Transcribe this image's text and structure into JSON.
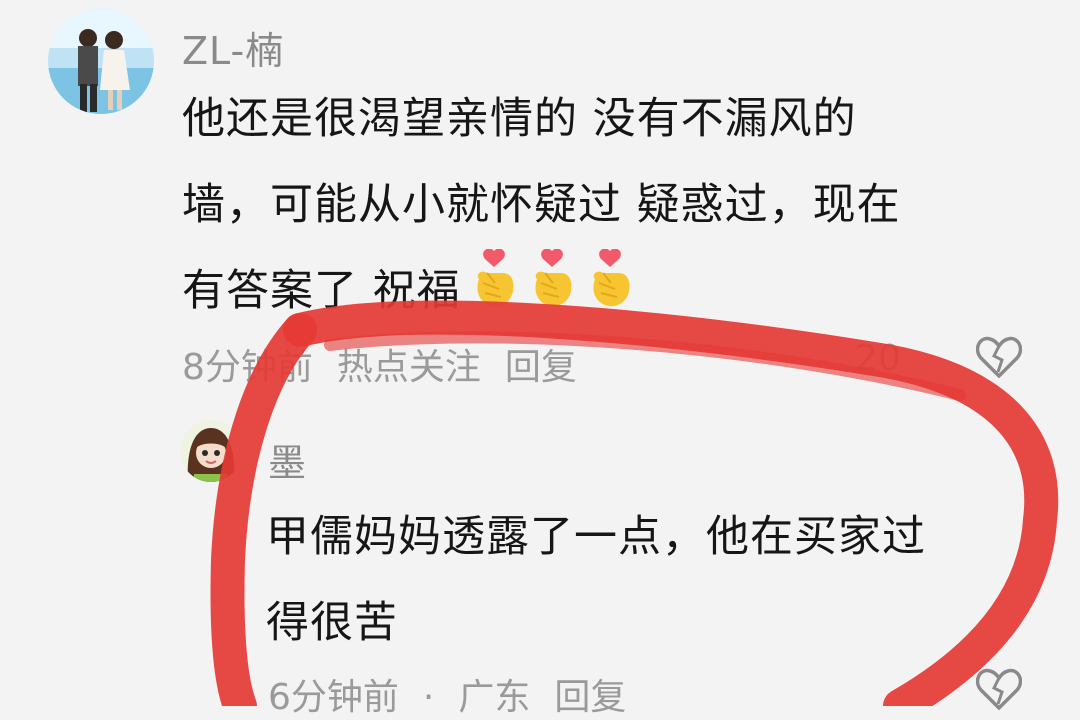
{
  "comment1": {
    "username": "ZL-楠",
    "text_line1": "他还是很渴望亲情的  没有不漏风的",
    "text_line2": "墙，可能从小就怀疑过 疑惑过，现在",
    "text_line3": "有答案了  祝福",
    "emoji": "finger-heart-emoji",
    "time": "8分钟前",
    "tag": "热点关注",
    "reply_label": "回复",
    "like_count": "20"
  },
  "comment2": {
    "username": "墨",
    "text_line1": "甲儒妈妈透露了一点，他在买家过",
    "text_line2": "得很苦",
    "time": "6分钟前",
    "separator": "·",
    "location": "广东",
    "reply_label": "回复"
  },
  "colors": {
    "annotation_red": "#e53935",
    "meta_gray": "#9a9a9a"
  }
}
